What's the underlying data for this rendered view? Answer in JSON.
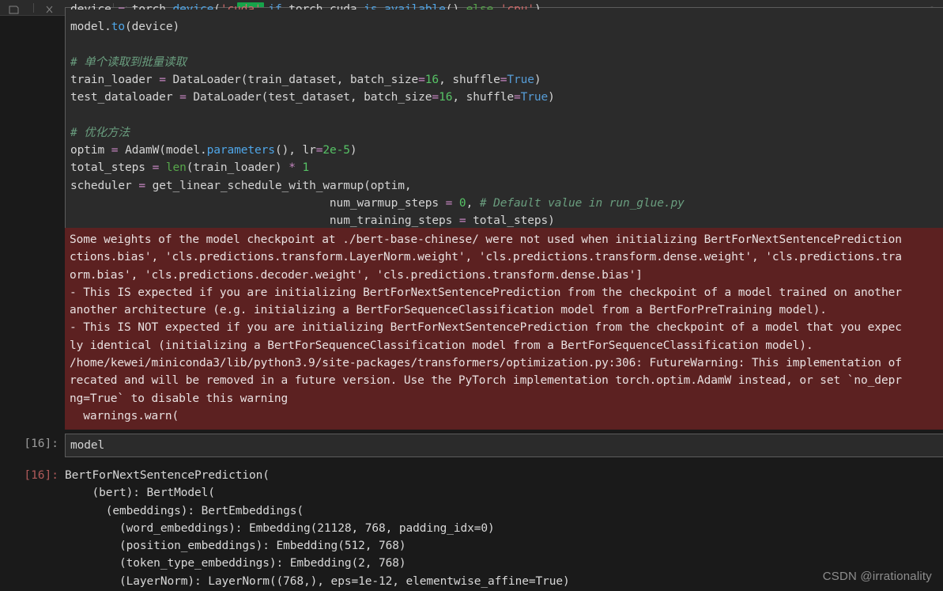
{
  "toolbar": {
    "icons": [
      "save-icon",
      "add-cell-icon",
      "cut-icon",
      "copy-icon",
      "paste-icon",
      "run-icon",
      "stop-icon",
      "restart-icon",
      "kernel-busy-indicator",
      "settings-icon"
    ],
    "busy_color": "#16a34a"
  },
  "input_cell_1": {
    "clipped_top_line": "device = torch.device( 'cuda' if torch.cuda.is_available() else 'cpu' )",
    "lines": [
      "model.to(device)",
      "",
      "# 单个读取到批量读取",
      "train_loader = DataLoader(train_dataset, batch_size=16, shuffle=True)",
      "test_dataloader = DataLoader(test_dataset, batch_size=16, shuffle=True)",
      "",
      "# 优化方法",
      "optim = AdamW(model.parameters(), lr=2e-5)",
      "total_steps = len(train_loader) * 1",
      "scheduler = get_linear_schedule_with_warmup(optim,",
      "                                      num_warmup_steps = 0, # Default value in run_glue.py",
      "                                      num_training_steps = total_steps)"
    ]
  },
  "error_output": {
    "background": "#5c2121",
    "lines": [
      "Some weights of the model checkpoint at ./bert-base-chinese/ were not used when initializing BertForNextSentencePrediction",
      "ctions.bias', 'cls.predictions.transform.LayerNorm.weight', 'cls.predictions.transform.dense.weight', 'cls.predictions.tra",
      "orm.bias', 'cls.predictions.decoder.weight', 'cls.predictions.transform.dense.bias']",
      "- This IS expected if you are initializing BertForNextSentencePrediction from the checkpoint of a model trained on another",
      "another architecture (e.g. initializing a BertForSequenceClassification model from a BertForPreTraining model).",
      "- This IS NOT expected if you are initializing BertForNextSentencePrediction from the checkpoint of a model that you expec",
      "ly identical (initializing a BertForSequenceClassification model from a BertForSequenceClassification model).",
      "/home/kewei/miniconda3/lib/python3.9/site-packages/transformers/optimization.py:306: FutureWarning: This implementation of",
      "recated and will be removed in a future version. Use the PyTorch implementation torch.optim.AdamW instead, or set `no_depr",
      "ng=True` to disable this warning",
      "  warnings.warn("
    ]
  },
  "input_cell_2": {
    "prompt": "[16]:",
    "code": "model"
  },
  "output_cell_2": {
    "prompt": "[16]:",
    "lines": [
      "BertForNextSentencePrediction(",
      "    (bert): BertModel(",
      "      (embeddings): BertEmbeddings(",
      "        (word_embeddings): Embedding(21128, 768, padding_idx=0)",
      "        (position_embeddings): Embedding(512, 768)",
      "        (token_type_embeddings): Embedding(2, 768)",
      "        (LayerNorm): LayerNorm((768,), eps=1e-12, elementwise_affine=True)"
    ]
  },
  "watermark": {
    "text": "CSDN @irrationality"
  }
}
